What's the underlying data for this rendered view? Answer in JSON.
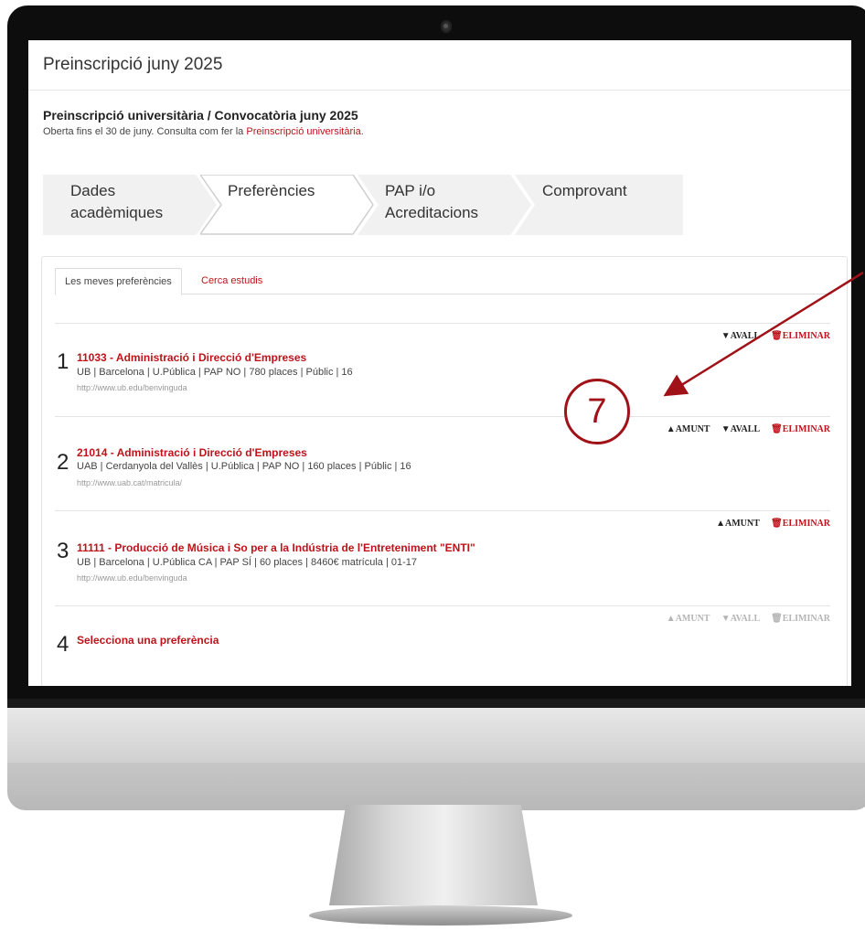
{
  "page": {
    "title": "Preinscripció juny 2025",
    "subhead": "Preinscripció universitària / Convocatòria juny 2025",
    "note_prefix": "Oberta fins el 30 de juny. Consulta com fer la ",
    "note_link": "Preinscripció universitària",
    "note_suffix": "."
  },
  "steps": [
    {
      "line1": "Dades",
      "line2": "acadèmiques"
    },
    {
      "line1": "Preferències",
      "line2": ""
    },
    {
      "line1": "PAP i/o",
      "line2": "Acreditacions"
    },
    {
      "line1": "Comprovant",
      "line2": ""
    }
  ],
  "tabs": {
    "active": "Les meves preferències",
    "other": "Cerca estudis"
  },
  "preferences": [
    {
      "num": "1",
      "title": "11033 - Administració i Direcció d'Empreses",
      "detail": "UB | Barcelona | U.Pública | PAP NO | 780 places | Públic | 16",
      "url": "http://www.ub.edu/benvinguda"
    },
    {
      "num": "2",
      "title": "21014 - Administració i Direcció d'Empreses",
      "detail": "UAB | Cerdanyola del Vallès | U.Pública | PAP NO | 160 places | Públic | 16",
      "url": "http://www.uab.cat/matricula/"
    },
    {
      "num": "3",
      "title": "11111 - Producció de Música i So per a la Indústria de l'Entreteniment \"ENTI\"",
      "detail": "UB | Barcelona | U.Pública CA | PAP SÍ | 60 places | 8460€ matrícula | 01-17",
      "url": "http://www.ub.edu/benvinguda"
    },
    {
      "num": "4",
      "title": "Selecciona una preferència"
    }
  ],
  "actions": {
    "up": "▲AMUNT",
    "down": "▼AVALL",
    "delete": "🗑ELIMINAR"
  },
  "annotation": {
    "number": "7"
  },
  "colors": {
    "accent": "#c0121a",
    "annotation": "#a01218"
  }
}
